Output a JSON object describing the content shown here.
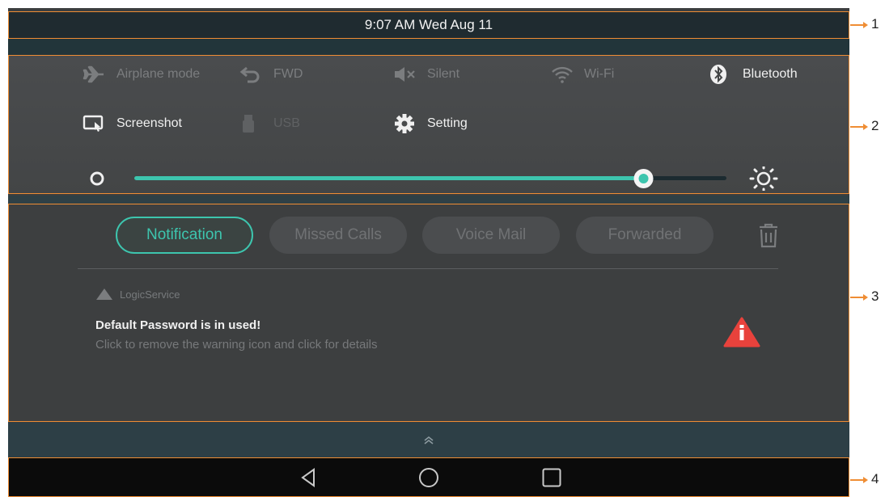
{
  "status_bar": {
    "datetime": "9:07 AM Wed Aug 11"
  },
  "quick_settings": {
    "row1": [
      {
        "label": "Airplane mode",
        "icon": "airplane-icon",
        "state": "off"
      },
      {
        "label": "FWD",
        "icon": "forward-icon",
        "state": "off"
      },
      {
        "label": "Silent",
        "icon": "speaker-mute-icon",
        "state": "off"
      },
      {
        "label": "Wi-Fi",
        "icon": "wifi-icon",
        "state": "off"
      },
      {
        "label": "Bluetooth",
        "icon": "bluetooth-icon",
        "state": "on"
      }
    ],
    "row2": [
      {
        "label": "Screenshot",
        "icon": "screenshot-icon",
        "state": "on"
      },
      {
        "label": "USB",
        "icon": "usb-icon",
        "state": "disabled"
      },
      {
        "label": "Setting",
        "icon": "gear-icon",
        "state": "on"
      }
    ],
    "brightness": {
      "level": 0.86,
      "min_icon": "brightness-low-icon",
      "max_icon": "brightness-high-icon"
    }
  },
  "notification_panel": {
    "tabs": [
      {
        "label": "Notification",
        "active": true
      },
      {
        "label": "Missed Calls",
        "active": false
      },
      {
        "label": "Voice Mail",
        "active": false
      },
      {
        "label": "Forwarded",
        "active": false
      }
    ],
    "delete_icon": "trash-icon",
    "notification": {
      "app": "LogicService",
      "title": "Default Password is in used!",
      "body": "Click to remove the warning icon and click for details",
      "icon": "warning-icon"
    }
  },
  "handle": {
    "icon": "chevron-up-icon"
  },
  "nav_bar": {
    "back_icon": "back-icon",
    "home_icon": "home-icon",
    "recents_icon": "recents-icon"
  },
  "callouts": [
    "1",
    "2",
    "3",
    "4"
  ],
  "colors": {
    "accent": "#3dc5ae",
    "callout": "#ef8d34",
    "warning": "#e8423c"
  }
}
